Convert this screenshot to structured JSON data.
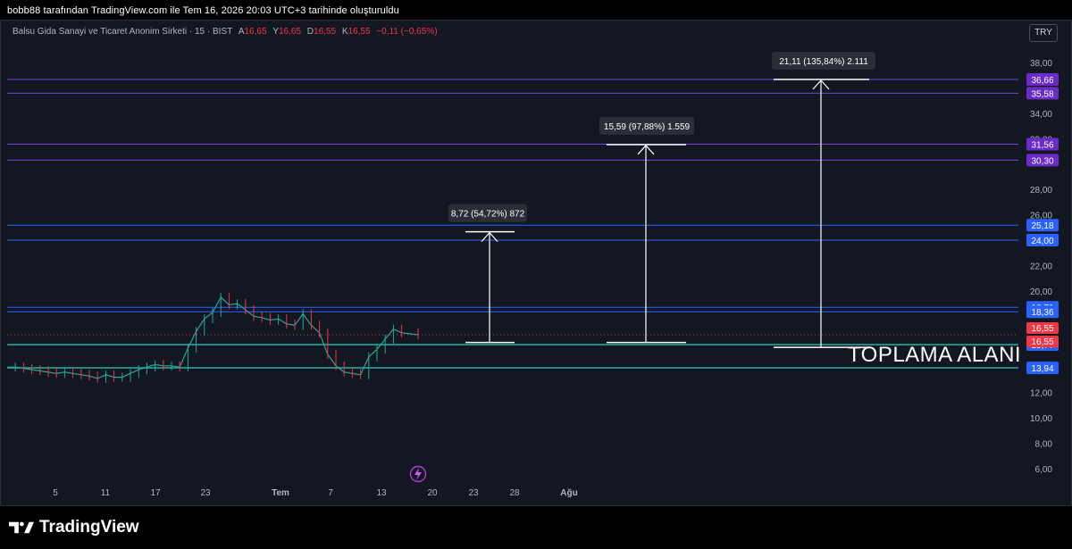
{
  "header": {
    "created_by": "bobb88 tarafından TradingView.com ile Tem 16, 2026 20:03 UTC+3 tarihinde oluşturuldu"
  },
  "legend": {
    "symbol": "Balsu Gida Sanayi ve Ticaret Anonim Sirketi · 15 · BIST",
    "open_label": "A",
    "open_value": "16,65",
    "high_label": "Y",
    "high_value": "16,65",
    "low_label": "D",
    "low_value": "16,55",
    "close_label": "K",
    "close_value": "16,55",
    "change": "−0,11 (−0,65%)"
  },
  "currency_button": "TRY",
  "chart_data": {
    "type": "candlestick",
    "ylim": [
      5,
      40
    ],
    "y_ticks": [
      {
        "v": 38,
        "label": "38,00"
      },
      {
        "v": 34,
        "label": "34,00"
      },
      {
        "v": 32,
        "label": "32,00"
      },
      {
        "v": 28,
        "label": "28,00"
      },
      {
        "v": 26,
        "label": "26,00"
      },
      {
        "v": 22,
        "label": "22,00"
      },
      {
        "v": 20,
        "label": "20,00"
      },
      {
        "v": 12,
        "label": "12,00"
      },
      {
        "v": 10,
        "label": "10,00"
      },
      {
        "v": 8,
        "label": "8,00"
      },
      {
        "v": 6,
        "label": "6,00"
      }
    ],
    "x_ticks": [
      "5",
      "11",
      "17",
      "23",
      "Tem",
      "7",
      "13",
      "20",
      "23",
      "28",
      "Ağu"
    ],
    "levels": [
      {
        "value": 36.66,
        "label": "36,66",
        "color": "#7b3fe4",
        "badge": "#6a2bc9"
      },
      {
        "value": 35.58,
        "label": "35,58",
        "color": "#7b3fe4",
        "badge": "#6a2bc9"
      },
      {
        "value": 31.56,
        "label": "31,56",
        "color": "#7b3fe4",
        "badge": "#6a2bc9"
      },
      {
        "value": 30.3,
        "label": "30,30",
        "color": "#7b3fe4",
        "badge": "#6a2bc9"
      },
      {
        "value": 25.18,
        "label": "25,18",
        "color": "#2962ff",
        "badge": "#2962ff"
      },
      {
        "value": 24.0,
        "label": "24,00",
        "color": "#2962ff",
        "badge": "#2962ff"
      },
      {
        "value": 18.71,
        "label": "18,71",
        "color": "#2962ff",
        "badge": "#2962ff"
      },
      {
        "value": 18.36,
        "label": "18,36",
        "color": "#2962ff",
        "badge": "#2962ff"
      },
      {
        "value": 15.77,
        "label": "15,77",
        "color": "#26a69a",
        "badge": "#2962ff"
      },
      {
        "value": 13.94,
        "label": "13,94",
        "color": "#26a69a",
        "badge": "#2962ff"
      }
    ],
    "price_badges": [
      {
        "value": 16.55,
        "label": "16,55",
        "color": "#f23645"
      },
      {
        "value": 16.55,
        "label": "16,55",
        "color": "#f23645"
      }
    ],
    "measures": [
      {
        "label": "8,72 (54,72%) 872",
        "from": 15.94,
        "to": 24.66
      },
      {
        "label": "15,59 (97,88%) 1.559",
        "from": 15.94,
        "to": 31.53
      },
      {
        "label": "21,11 (135,84%) 2.111",
        "from": 15.55,
        "to": 36.66
      }
    ],
    "annotation": "TOPLAMA ALANI",
    "series": [
      {
        "x": 0.0,
        "y": 14.0
      },
      {
        "x": 0.02,
        "y": 14.0
      },
      {
        "x": 0.04,
        "y": 13.9
      },
      {
        "x": 0.06,
        "y": 13.8
      },
      {
        "x": 0.08,
        "y": 13.7
      },
      {
        "x": 0.1,
        "y": 13.6
      },
      {
        "x": 0.12,
        "y": 13.5
      },
      {
        "x": 0.14,
        "y": 13.6
      },
      {
        "x": 0.16,
        "y": 13.5
      },
      {
        "x": 0.18,
        "y": 13.4
      },
      {
        "x": 0.2,
        "y": 13.3
      },
      {
        "x": 0.22,
        "y": 13.1
      },
      {
        "x": 0.24,
        "y": 13.4
      },
      {
        "x": 0.26,
        "y": 13.2
      },
      {
        "x": 0.28,
        "y": 13.2
      },
      {
        "x": 0.3,
        "y": 13.5
      },
      {
        "x": 0.32,
        "y": 13.8
      },
      {
        "x": 0.34,
        "y": 14.0
      },
      {
        "x": 0.36,
        "y": 14.2
      },
      {
        "x": 0.38,
        "y": 14.1
      },
      {
        "x": 0.4,
        "y": 14.1
      },
      {
        "x": 0.42,
        "y": 14.0
      },
      {
        "x": 0.44,
        "y": 15.5
      },
      {
        "x": 0.46,
        "y": 16.8
      },
      {
        "x": 0.48,
        "y": 17.8
      },
      {
        "x": 0.5,
        "y": 18.3
      },
      {
        "x": 0.52,
        "y": 19.5
      },
      {
        "x": 0.54,
        "y": 18.9
      },
      {
        "x": 0.56,
        "y": 19.0
      },
      {
        "x": 0.58,
        "y": 18.5
      },
      {
        "x": 0.6,
        "y": 18.0
      },
      {
        "x": 0.62,
        "y": 17.9
      },
      {
        "x": 0.64,
        "y": 17.7
      },
      {
        "x": 0.66,
        "y": 17.8
      },
      {
        "x": 0.68,
        "y": 17.4
      },
      {
        "x": 0.7,
        "y": 17.3
      },
      {
        "x": 0.72,
        "y": 18.2
      },
      {
        "x": 0.74,
        "y": 17.3
      },
      {
        "x": 0.76,
        "y": 16.7
      },
      {
        "x": 0.78,
        "y": 15.0
      },
      {
        "x": 0.8,
        "y": 14.1
      },
      {
        "x": 0.82,
        "y": 13.6
      },
      {
        "x": 0.84,
        "y": 13.5
      },
      {
        "x": 0.86,
        "y": 13.4
      },
      {
        "x": 0.88,
        "y": 14.8
      },
      {
        "x": 0.9,
        "y": 15.4
      },
      {
        "x": 0.92,
        "y": 16.2
      },
      {
        "x": 0.94,
        "y": 17.0
      },
      {
        "x": 0.96,
        "y": 16.7
      },
      {
        "x": 1.0,
        "y": 16.55
      }
    ]
  },
  "footer": {
    "brand": "TradingView"
  }
}
